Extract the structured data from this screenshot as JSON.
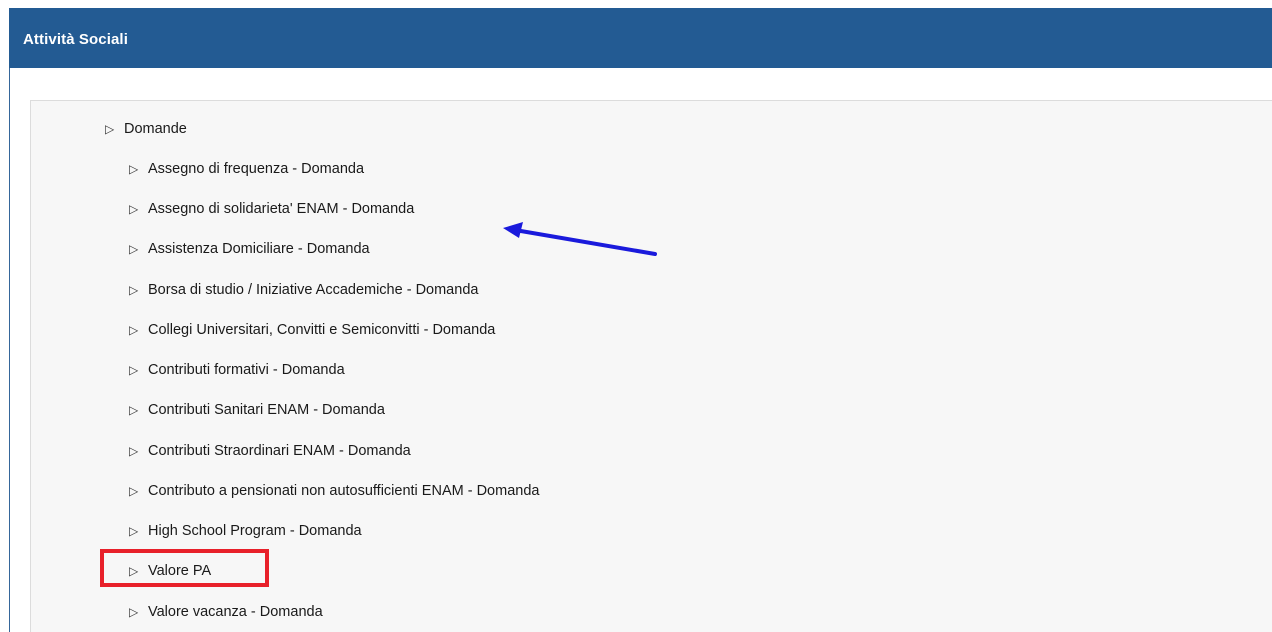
{
  "header": {
    "title": "Attività Sociali"
  },
  "tree": {
    "root_label": "Domande",
    "items": [
      "Assegno di frequenza - Domanda",
      "Assegno di solidarieta' ENAM - Domanda",
      "Assistenza Domiciliare - Domanda",
      "Borsa di studio / Iniziative Accademiche - Domanda",
      "Collegi Universitari, Convitti e Semiconvitti - Domanda",
      "Contributi formativi - Domanda",
      "Contributi Sanitari ENAM - Domanda",
      "Contributi Straordinari ENAM - Domanda",
      "Contributo a pensionati non autosufficienti ENAM - Domanda",
      "High School Program - Domanda",
      "Valore PA",
      "Valore vacanza - Domanda"
    ]
  },
  "annotations": {
    "arrow_color": "#1a1adc",
    "box_color": "#e8202a"
  }
}
